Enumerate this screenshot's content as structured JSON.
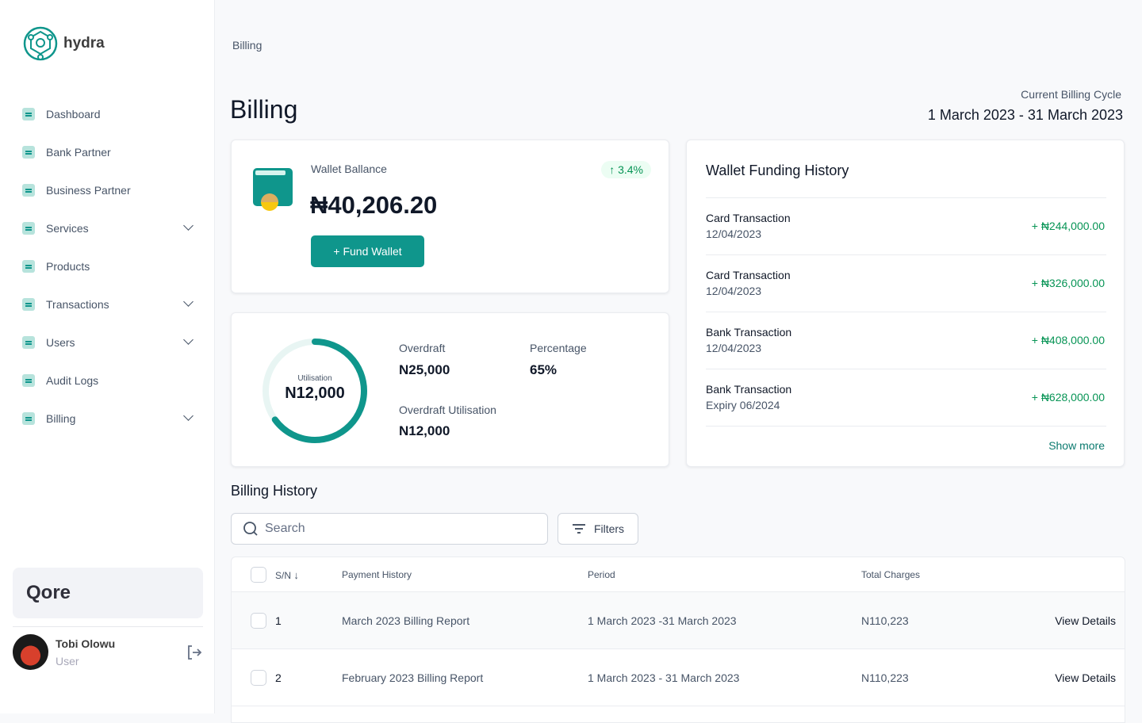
{
  "brand": {
    "name": "hydra",
    "accent": "#0f968c"
  },
  "sidebar": {
    "items": [
      {
        "label": "Dashboard",
        "icon": "dashboard-icon",
        "expandable": false
      },
      {
        "label": "Bank Partner",
        "icon": "bank-icon",
        "expandable": false
      },
      {
        "label": "Business Partner",
        "icon": "briefcase-icon",
        "expandable": false
      },
      {
        "label": "Services",
        "icon": "services-icon",
        "expandable": true
      },
      {
        "label": "Products",
        "icon": "products-icon",
        "expandable": false
      },
      {
        "label": "Transactions",
        "icon": "transactions-icon",
        "expandable": true
      },
      {
        "label": "Users",
        "icon": "users-icon",
        "expandable": true
      },
      {
        "label": "Audit Logs",
        "icon": "audit-icon",
        "expandable": false
      },
      {
        "label": "Billing",
        "icon": "billing-icon",
        "expandable": true
      }
    ],
    "org": "Qore",
    "user": {
      "name": "Tobi Olowu",
      "role": "User"
    }
  },
  "header": {
    "breadcrumb": "Billing",
    "title": "Billing",
    "cycle_label": "Current Billing Cycle",
    "cycle_value": "1 March 2023 - 31 March 2023"
  },
  "wallet": {
    "label": "Wallet Ballance",
    "amount": "₦40,206.20",
    "change": "3.4%",
    "fund_label": "+ Fund Wallet"
  },
  "overdraft": {
    "ring_label": "Utilisation",
    "ring_value": "N12,000",
    "utilisation_percent": 65,
    "overdraft_label": "Overdraft",
    "overdraft_value": "N25,000",
    "percentage_label": "Percentage",
    "percentage_value": "65%",
    "util_label": "Overdraft Utilisation",
    "util_value": "N12,000"
  },
  "funding": {
    "title": "Wallet Funding History",
    "items": [
      {
        "type": "Card Transaction",
        "date": "12/04/2023",
        "amount": "+ ₦244,000.00"
      },
      {
        "type": "Card Transaction",
        "date": "12/04/2023",
        "amount": "+ ₦326,000.00"
      },
      {
        "type": "Bank Transaction",
        "date": "12/04/2023",
        "amount": "+ ₦408,000.00"
      },
      {
        "type": "Bank Transaction",
        "date": "Expiry 06/2024",
        "amount": "+ ₦628,000.00"
      }
    ],
    "show_more": "Show more"
  },
  "history": {
    "title": "Billing History",
    "search_placeholder": "Search",
    "filters_label": "Filters",
    "columns": [
      "S/N",
      "Payment History",
      "Period",
      "Total Charges"
    ],
    "rows": [
      {
        "sn": "1",
        "name": "March 2023 Billing Report",
        "period": "1 March 2023 -31 March 2023",
        "total": "N110,223",
        "action": "View Details"
      },
      {
        "sn": "2",
        "name": "February 2023 Billing Report",
        "period": "1 March 2023 - 31 March 2023",
        "total": "N110,223",
        "action": "View Details"
      }
    ]
  }
}
